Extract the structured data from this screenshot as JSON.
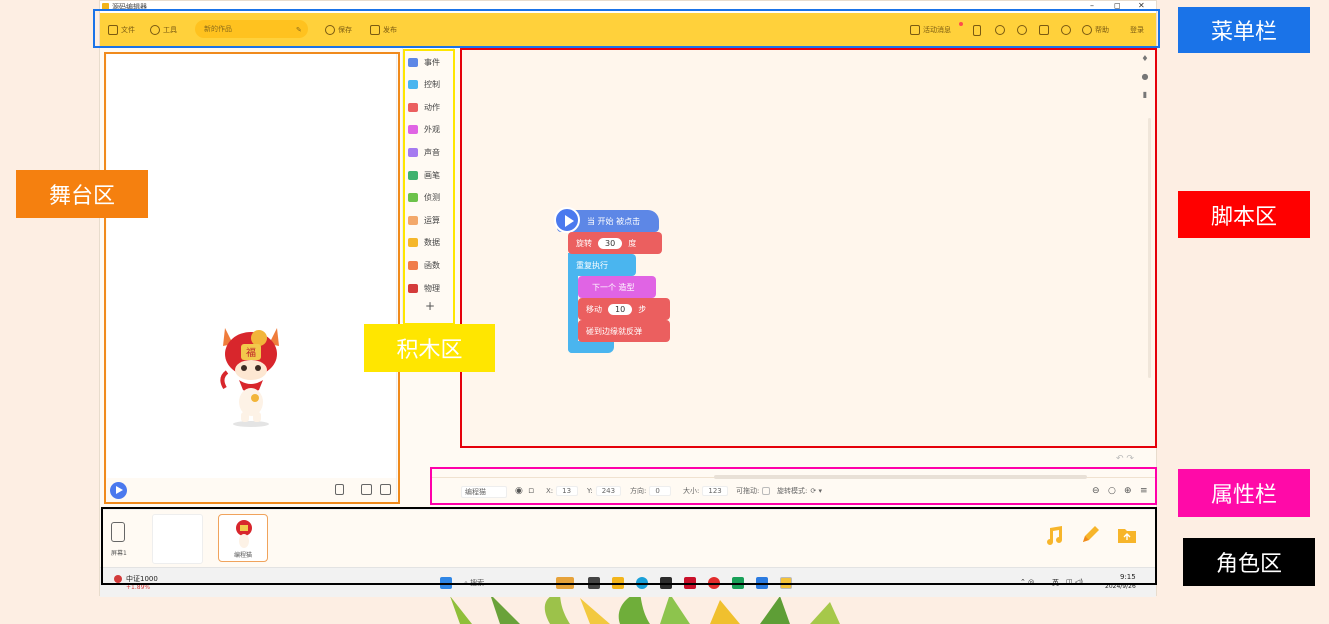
{
  "window": {
    "title": "源码编辑器"
  },
  "menubar": {
    "file": "文件",
    "tools": "工具",
    "project_name": "新的作品",
    "save": "保存",
    "publish": "发布",
    "events": "活动消息",
    "help": "帮助",
    "login": "登录"
  },
  "palette": {
    "categories": [
      {
        "label": "事件",
        "color": "#5d87e6"
      },
      {
        "label": "控制",
        "color": "#4ab5ef"
      },
      {
        "label": "动作",
        "color": "#eb5f5f"
      },
      {
        "label": "外观",
        "color": "#e064e4"
      },
      {
        "label": "声音",
        "color": "#a57af0"
      },
      {
        "label": "画笔",
        "color": "#3fb26f"
      },
      {
        "label": "侦测",
        "color": "#6cc24a"
      },
      {
        "label": "运算",
        "color": "#f3a86a"
      },
      {
        "label": "数据",
        "color": "#f5b72b"
      },
      {
        "label": "函数",
        "color": "#f07c4a"
      },
      {
        "label": "物理",
        "color": "#d43b3b"
      }
    ],
    "add": "+"
  },
  "script": {
    "hat": "当 开始 被点击",
    "turn_label": "旋转",
    "turn_value": "30",
    "turn_unit": "度",
    "repeat": "重复执行",
    "next_costume": "下一个 造型",
    "move_label": "移动",
    "move_value": "10",
    "move_unit": "步",
    "bounce": "碰到边缘就反弹"
  },
  "attributes": {
    "name": "编程猫",
    "x_label": "X:",
    "x_value": "13",
    "y_label": "Y:",
    "y_value": "243",
    "direction_label": "方向:",
    "direction_value": "0",
    "size_label": "大小:",
    "size_value": "123",
    "draggable_label": "可拖动:",
    "rotation_label": "旋转模式:"
  },
  "sprites": {
    "stage_label": "屏幕1",
    "sprite_label": "编程猫"
  },
  "taskbar": {
    "weather_title": "中证1000",
    "weather_sub": "+1.89%",
    "search": "搜索",
    "lang": "英",
    "time": "9:15",
    "date": "2024/9/26"
  },
  "annotations": {
    "menubar": "菜单栏",
    "stage": "舞台区",
    "blocks": "积木区",
    "script": "脚本区",
    "attributes": "属性栏",
    "sprites": "角色区"
  },
  "colors": {
    "menubar": "#ffd13b",
    "stage_frame": "#f08a1c",
    "blocks_frame": "#ffe600",
    "script_frame": "#e5000a",
    "attr_frame": "#ff00aa",
    "sprite_frame": "#000000",
    "menubar_frame": "#1a73e8"
  }
}
